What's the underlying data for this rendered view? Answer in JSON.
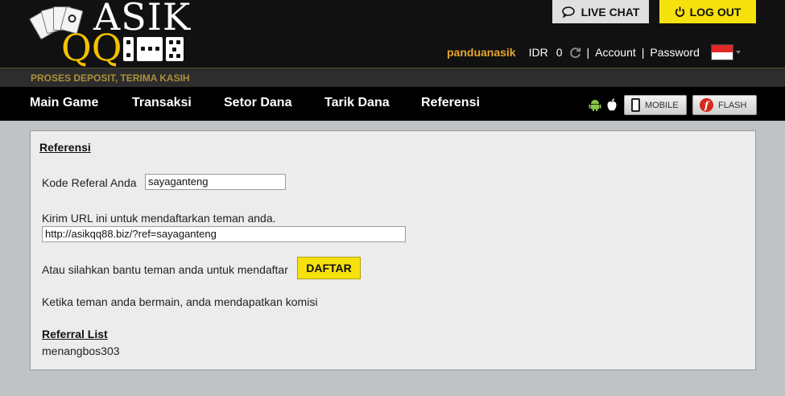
{
  "header": {
    "logo_top": "ASIK",
    "logo_bottom": "QQ",
    "live_chat_label": "LIVE CHAT",
    "logout_label": "LOG OUT",
    "username": "panduanasik",
    "currency": "IDR",
    "balance": "0",
    "account_link": "Account",
    "password_link": "Password",
    "separator": "|",
    "accent_color": "#f6e10c",
    "username_color": "#e6a52b"
  },
  "marquee": {
    "text": "PROSES DEPOSIT, TERIMA KASIH"
  },
  "nav": {
    "items": [
      "Main Game",
      "Transaksi",
      "Setor Dana",
      "Tarik Dana",
      "Referensi"
    ],
    "mobile_label": "MOBILE",
    "flash_label": "FLASH"
  },
  "referensi": {
    "title": "Referensi",
    "kode_label": "Kode Referal Anda",
    "kode_value": "sayaganteng",
    "kirim_label": "Kirim URL ini untuk mendaftarkan teman anda.",
    "url_value": "http://asikqq88.biz/?ref=sayaganteng",
    "bantu_label": "Atau silahkan bantu teman anda untuk mendaftar",
    "daftar_label": "DAFTAR",
    "komisi_label": "Ketika teman anda bermain, anda mendapatkan komisi",
    "list_title": "Referral List",
    "list": [
      "menangbos303"
    ]
  }
}
